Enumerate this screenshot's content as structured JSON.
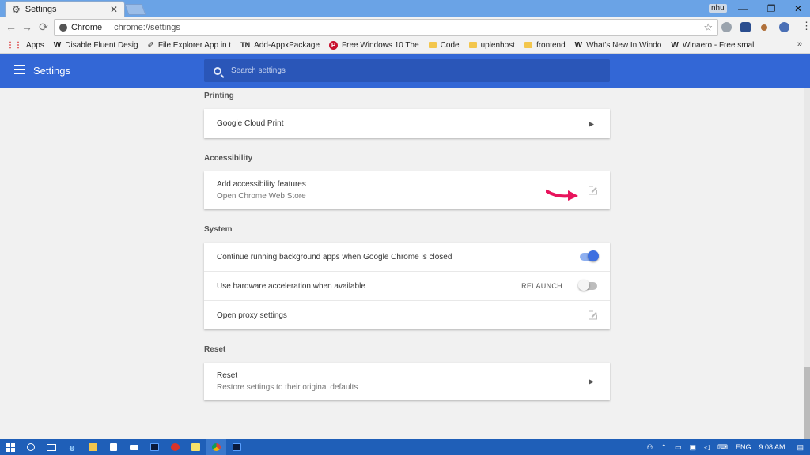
{
  "browser": {
    "tab_title": "Settings",
    "tab_close": "✕",
    "user_badge": "nhu",
    "window_controls": [
      "—",
      "❐",
      "✕"
    ],
    "nav": {
      "back": "←",
      "forward": "→",
      "reload": "⟳"
    },
    "site_chip": "Chrome",
    "url": "chrome://settings",
    "star": "☆",
    "menu": "⋮"
  },
  "bookmarks": {
    "items": [
      {
        "icon": "apps-grid-icon",
        "glyph": "⋮⋮",
        "label": "Apps"
      },
      {
        "icon": "winaero-icon",
        "glyph": "W",
        "label": "Disable Fluent Desig"
      },
      {
        "icon": "page-icon",
        "glyph": "✐",
        "label": "File Explorer App in t"
      },
      {
        "icon": "tn-icon",
        "glyph": "TN",
        "label": "Add-AppxPackage"
      },
      {
        "icon": "pinterest-icon",
        "glyph": "P",
        "label": "Free Windows 10 The"
      },
      {
        "icon": "folder-icon",
        "glyph": "",
        "label": "Code"
      },
      {
        "icon": "folder-icon",
        "glyph": "",
        "label": "uplenhost"
      },
      {
        "icon": "folder-icon",
        "glyph": "",
        "label": "frontend"
      },
      {
        "icon": "winaero-icon",
        "glyph": "W",
        "label": "What's New In Windo"
      },
      {
        "icon": "winaero-icon",
        "glyph": "W",
        "label": "Winaero - Free small"
      }
    ],
    "more": "»"
  },
  "settings": {
    "title": "Settings",
    "search_placeholder": "Search settings"
  },
  "sections": {
    "printing": {
      "title": "Printing",
      "google_cloud_print": "Google Cloud Print"
    },
    "accessibility": {
      "title": "Accessibility",
      "add_features": "Add accessibility features",
      "add_features_sub": "Open Chrome Web Store"
    },
    "system": {
      "title": "System",
      "background_apps": "Continue running background apps when Google Chrome is closed",
      "background_apps_on": true,
      "hw_accel": "Use hardware acceleration when available",
      "hw_accel_on": false,
      "relaunch": "RELAUNCH",
      "proxy": "Open proxy settings"
    },
    "reset": {
      "title": "Reset",
      "reset_label": "Reset",
      "reset_sub": "Restore settings to their original defaults"
    }
  },
  "taskbar": {
    "tray_lang": "ENG",
    "tray_time": "9:08 AM"
  },
  "colors": {
    "header_blue": "#3367d6",
    "toggle_on": "#3d6fe0",
    "annotation_arrow": "#e8145c"
  }
}
